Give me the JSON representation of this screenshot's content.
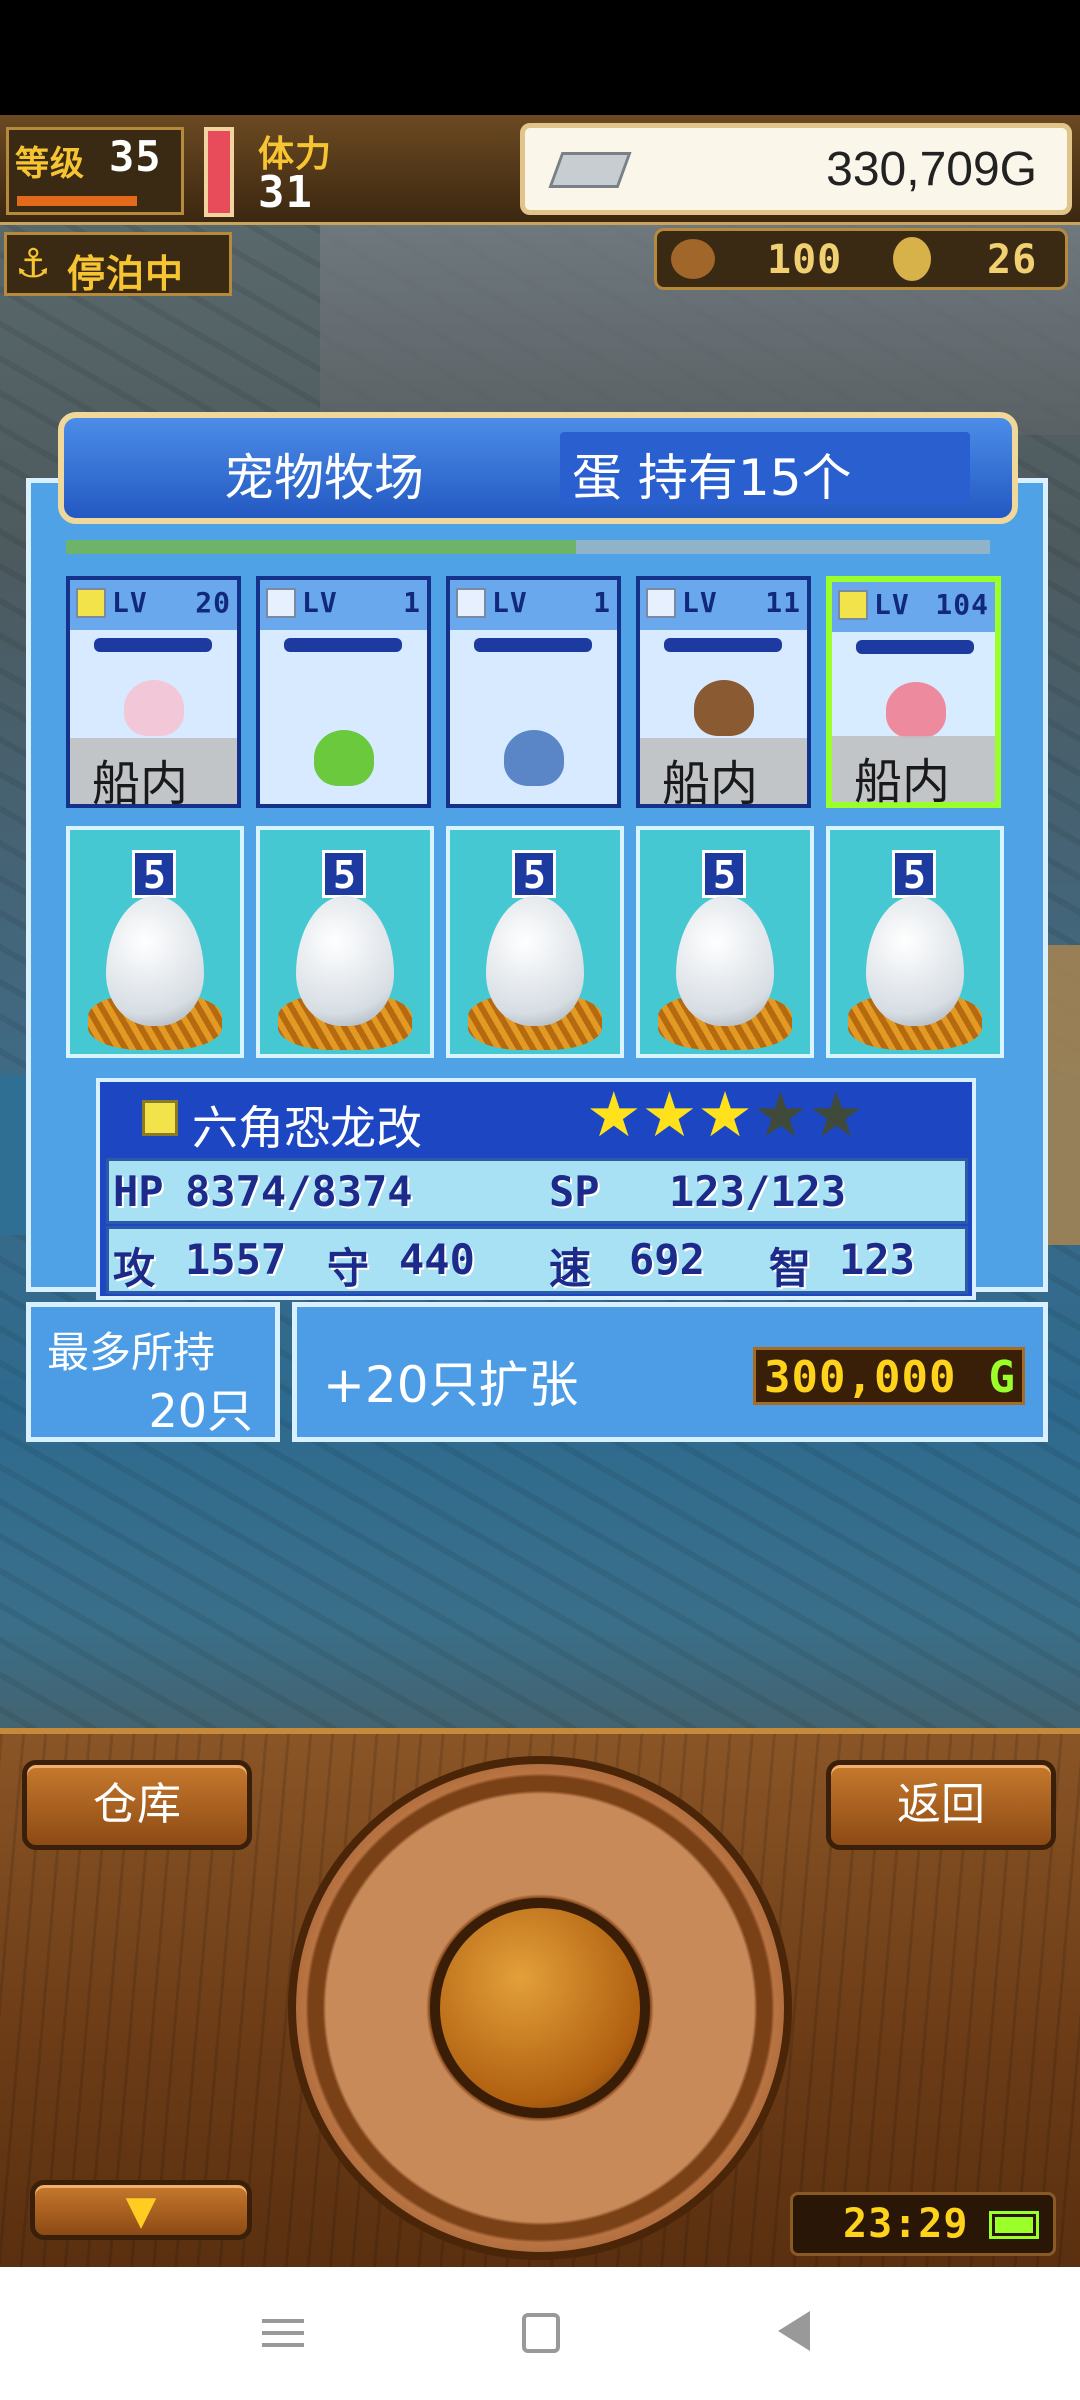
{
  "hud": {
    "level_label": "等级",
    "level": "35",
    "stamina_label": "体力",
    "stamina": "31",
    "gold": "330,709G",
    "docked_label": "停泊中",
    "wood_count": "100",
    "coin_count": "26"
  },
  "panel": {
    "title": "宠物牧场",
    "egg_label": "蛋 持有15个"
  },
  "pets": [
    {
      "lv": "LV",
      "level": "20",
      "location": "船内",
      "color": "#f2c8d8",
      "name": "pet-pink-rabbit"
    },
    {
      "lv": "LV",
      "level": "1",
      "location": "",
      "color": "#6ac93c",
      "name": "pet-green-slime"
    },
    {
      "lv": "LV",
      "level": "1",
      "location": "",
      "color": "#5a86c8",
      "name": "pet-blue-turtle"
    },
    {
      "lv": "LV",
      "level": "11",
      "location": "船内",
      "color": "#8a5a32",
      "name": "pet-brown-beast"
    },
    {
      "lv": "LV",
      "level": "104",
      "location": "船内",
      "color": "#ee8a9e",
      "name": "pet-pink-axolotl"
    }
  ],
  "eggs": [
    "5",
    "5",
    "5",
    "5",
    "5"
  ],
  "selected": {
    "name": "六角恐龙改",
    "stars_filled": 3,
    "stars_total": 5,
    "hp_label": "HP",
    "hp": "8374/8374",
    "sp_label": "SP",
    "sp": "123/123",
    "atk_label": "攻",
    "atk": "1557",
    "def_label": "守",
    "def": "440",
    "spd_label": "速",
    "spd": "692",
    "int_label": "智",
    "int": "123"
  },
  "capacity": {
    "label": "最多所持",
    "value": "20只"
  },
  "expand": {
    "label": "+20只扩张",
    "price": "300,000",
    "currency": "G"
  },
  "buttons": {
    "warehouse": "仓库",
    "back": "返回"
  },
  "clock": "23:29",
  "colors": {
    "accent_green": "#9bff2a",
    "star_yellow": "#ffe21c"
  }
}
